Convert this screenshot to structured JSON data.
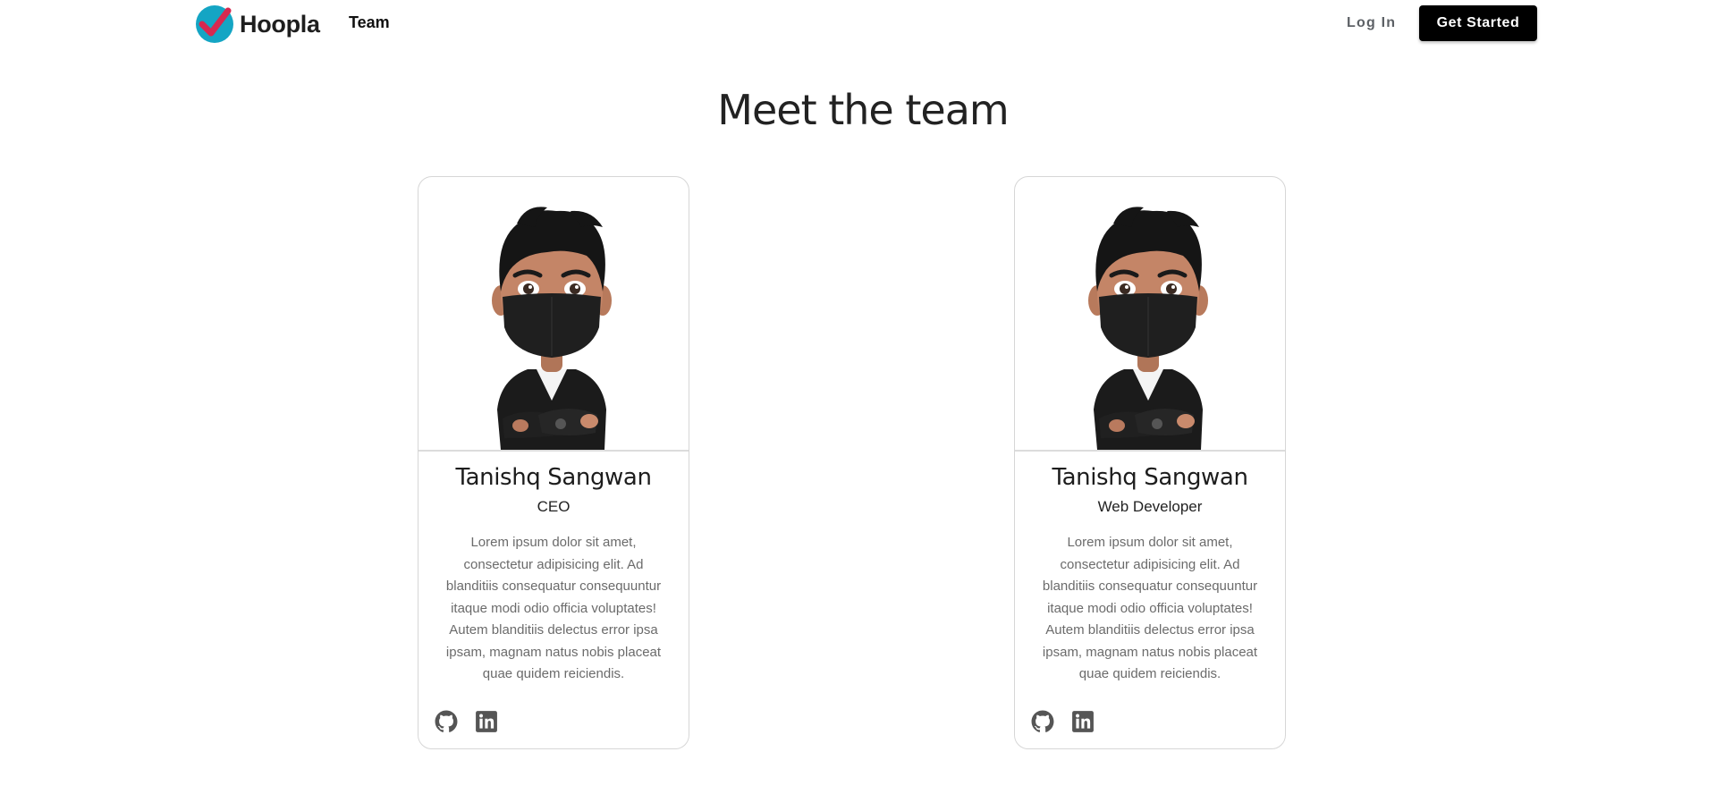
{
  "brand": {
    "name": "Hoopla",
    "accent": "#14a5c4",
    "check_color": "#d7284f"
  },
  "nav": {
    "team": "Team",
    "login": "Log In",
    "cta": "Get Started"
  },
  "page": {
    "title": "Meet the team"
  },
  "members": [
    {
      "name": "Tanishq Sangwan",
      "role": "CEO",
      "bio": "Lorem ipsum dolor sit amet, consectetur adipisicing elit. Ad blanditiis consequatur consequuntur itaque modi odio officia voluptates! Autem blanditiis delectus error ipsa ipsam, magnam natus nobis placeat quae quidem reiciendis.",
      "socials": [
        "github-icon",
        "linkedin-icon"
      ]
    },
    {
      "name": "Tanishq Sangwan",
      "role": "Web Developer",
      "bio": "Lorem ipsum dolor sit amet, consectetur adipisicing elit. Ad blanditiis consequatur consequuntur itaque modi odio officia voluptates! Autem blanditiis delectus error ipsa ipsam, magnam natus nobis placeat quae quidem reiciendis.",
      "socials": [
        "github-icon",
        "linkedin-icon"
      ]
    }
  ]
}
